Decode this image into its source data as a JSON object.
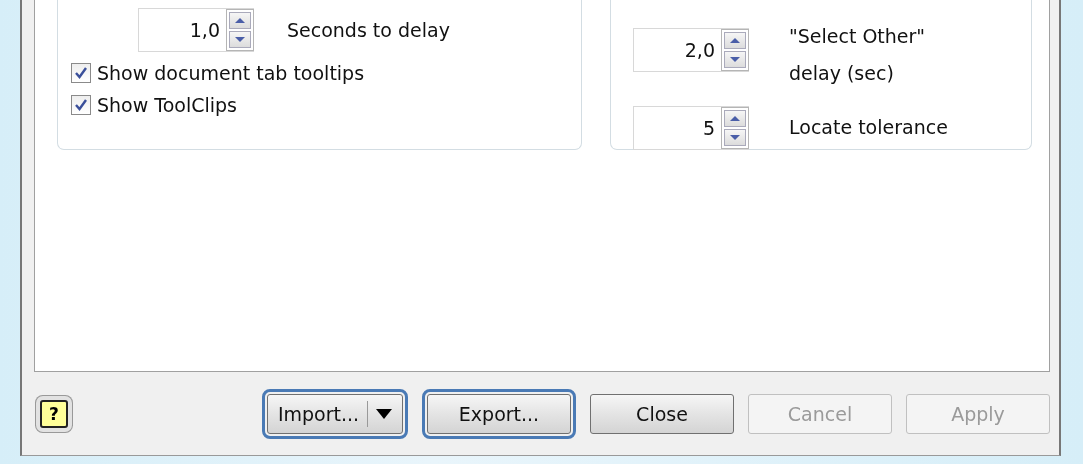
{
  "left_group": {
    "spinner": {
      "value": "1,0",
      "label": "Seconds to delay"
    },
    "checkboxes": [
      {
        "label": "Show document tab tooltips",
        "checked": true
      },
      {
        "label": "Show ToolClips",
        "checked": true
      }
    ]
  },
  "right_group": {
    "spinners": [
      {
        "value": "2,0",
        "label_lines": [
          "\"Select Other\"",
          "delay (sec)"
        ]
      },
      {
        "value": "5",
        "label_lines": [
          "Locate tolerance"
        ]
      }
    ]
  },
  "footer": {
    "help": "?",
    "buttons": [
      {
        "label": "Import...",
        "kind": "split",
        "highlighted": true,
        "disabled": false
      },
      {
        "label": "Export...",
        "kind": "plain",
        "highlighted": true,
        "disabled": false
      },
      {
        "label": "Close",
        "kind": "plain",
        "highlighted": false,
        "disabled": false
      },
      {
        "label": "Cancel",
        "kind": "plain",
        "highlighted": false,
        "disabled": true
      },
      {
        "label": "Apply",
        "kind": "plain",
        "highlighted": false,
        "disabled": true
      }
    ]
  }
}
